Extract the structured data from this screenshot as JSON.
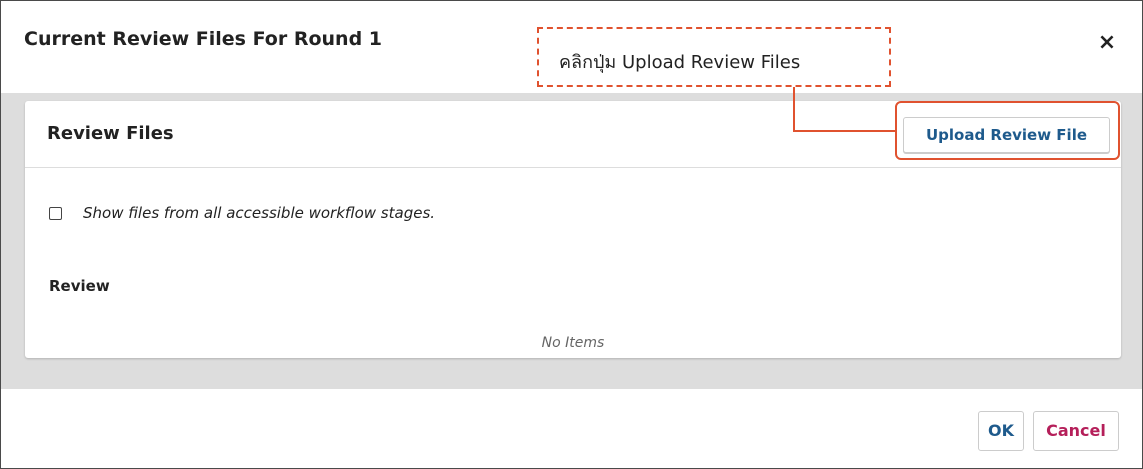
{
  "dialog": {
    "title": "Current Review Files For Round 1",
    "close_label": "×"
  },
  "panel": {
    "title": "Review Files",
    "upload_label": "Upload Review File",
    "checkbox_label": "Show files from all accessible workflow stages.",
    "checkbox_checked": false,
    "section_title": "Review",
    "empty_text": "No Items"
  },
  "footer": {
    "ok_label": "OK",
    "cancel_label": "Cancel"
  },
  "annotation": {
    "text": "คลิกปุ่ม Upload Review Files",
    "color": "#e0522f"
  },
  "colors": {
    "primary": "#1e5a8c",
    "cancel": "#b51f5a",
    "body_background": "#dddddd"
  }
}
